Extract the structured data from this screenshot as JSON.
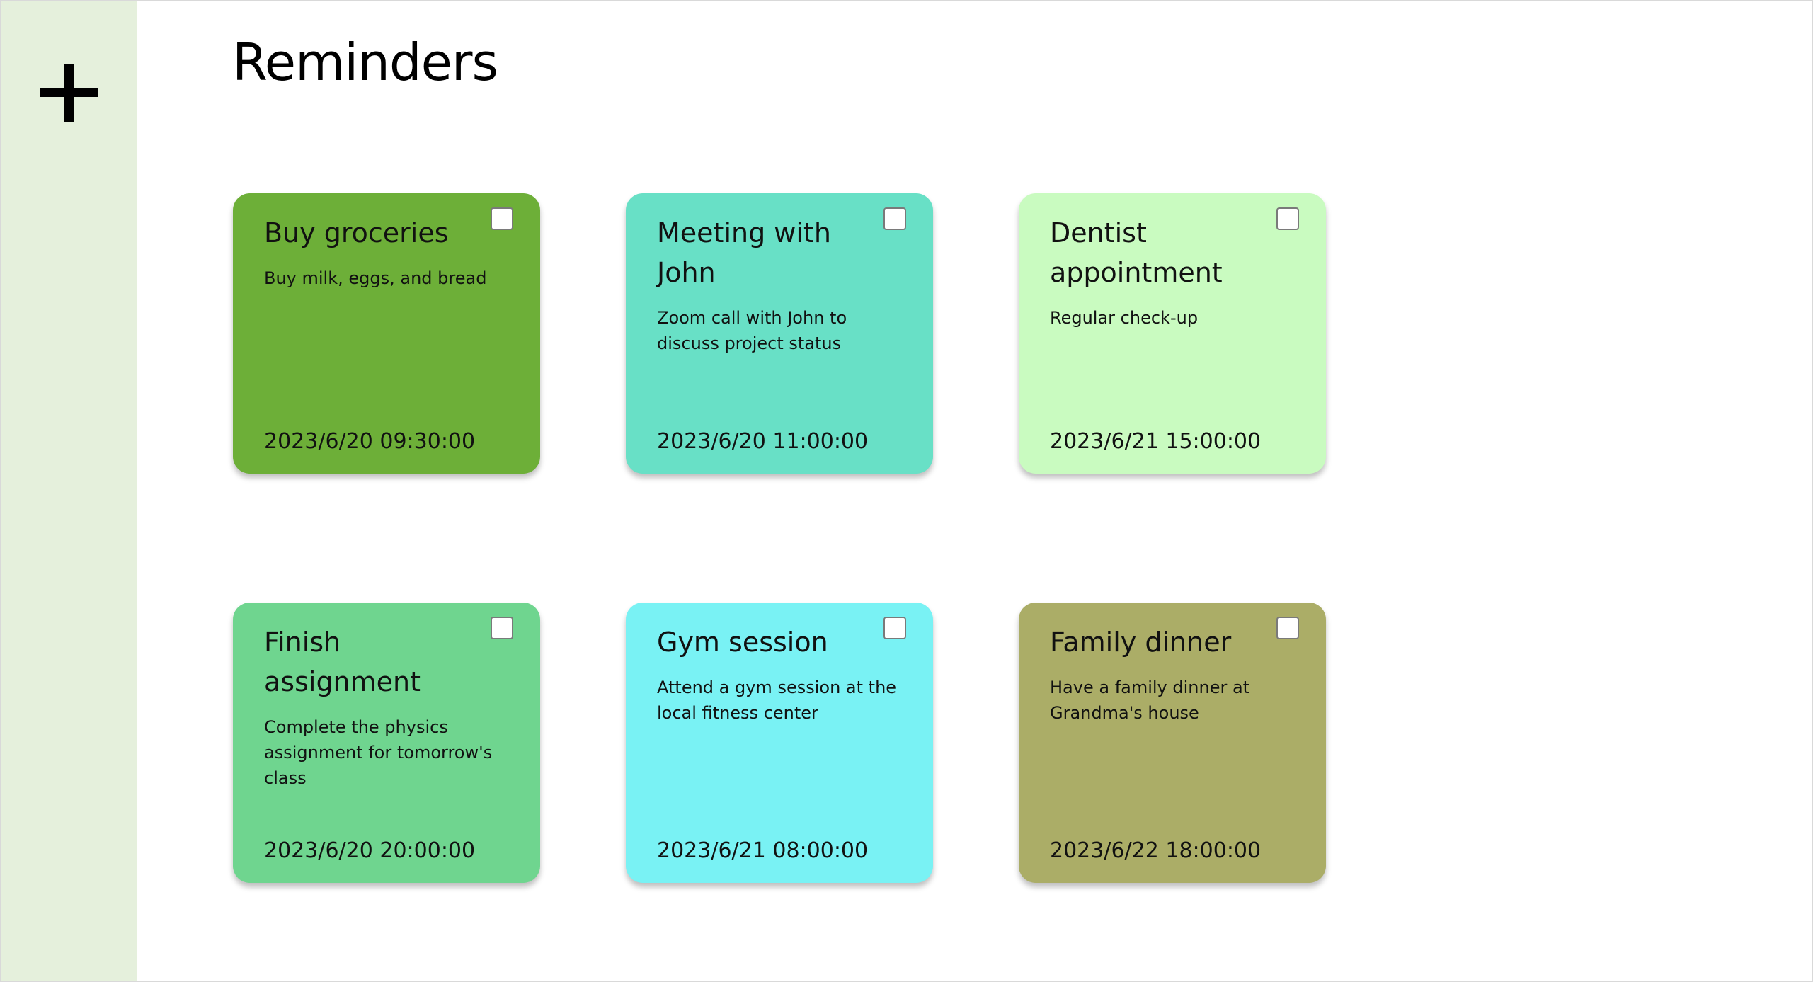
{
  "page": {
    "title": "Reminders"
  },
  "sidebar": {
    "add_icon": "plus-icon"
  },
  "reminders": [
    {
      "title": "Buy groceries",
      "description": "Buy milk, eggs, and bread",
      "datetime": "2023/6/20 09:30:00",
      "color": "#6daf38",
      "checked": false
    },
    {
      "title": "Meeting with John",
      "description": "Zoom call with John to discuss project status",
      "datetime": "2023/6/20 11:00:00",
      "color": "#68e0c6",
      "checked": false
    },
    {
      "title": "Dentist appointment",
      "description": "Regular check-up",
      "datetime": "2023/6/21 15:00:00",
      "color": "#c9fbc0",
      "checked": false
    },
    {
      "title": "Finish assignment",
      "description": "Complete the physics assignment for tomorrow's class",
      "datetime": "2023/6/20 20:00:00",
      "color": "#6fd58f",
      "checked": false
    },
    {
      "title": "Gym session",
      "description": "Attend a gym session at the local fitness center",
      "datetime": "2023/6/21 08:00:00",
      "color": "#79f2f4",
      "checked": false
    },
    {
      "title": "Family dinner",
      "description": "Have a family dinner at Grandma's house",
      "datetime": "2023/6/22 18:00:00",
      "color": "#abad67",
      "checked": false
    }
  ]
}
